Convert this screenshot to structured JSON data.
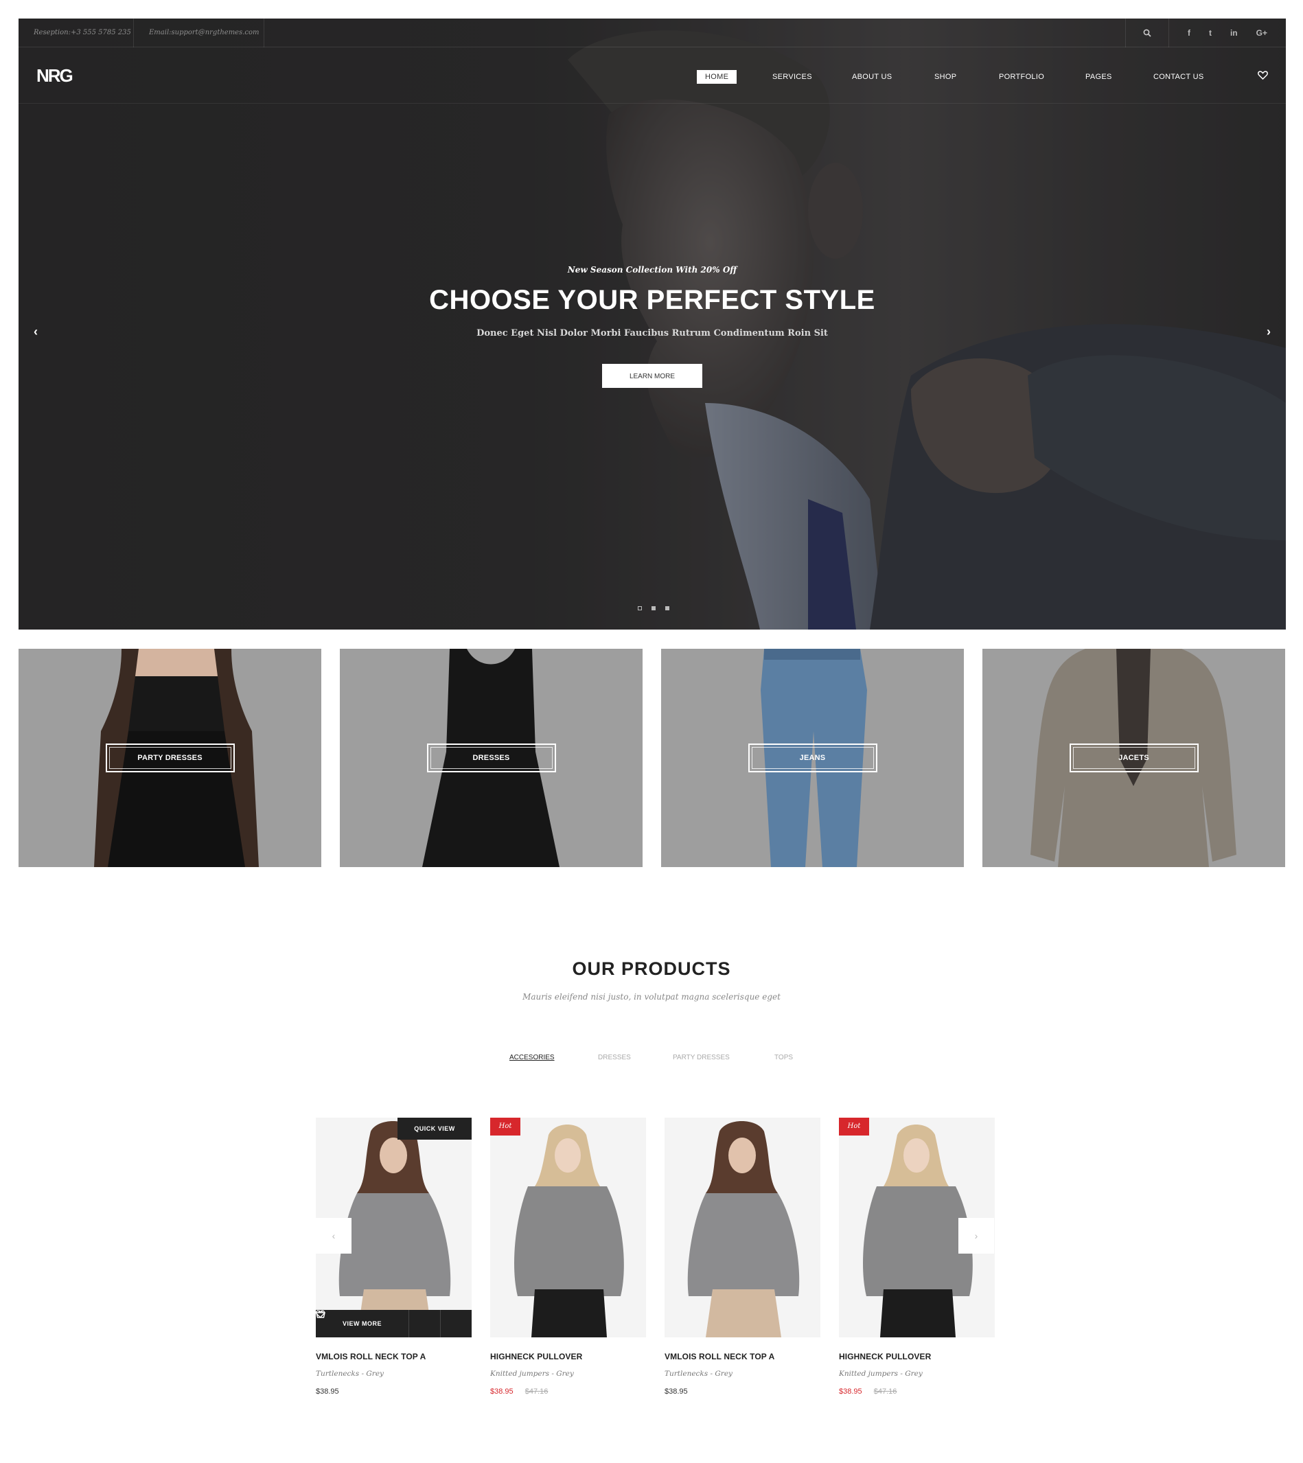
{
  "topbar": {
    "phone": "Reseption:+3 555 5785 235",
    "email": "Email:support@nrgthemes.com",
    "social_icons": [
      "facebook-icon",
      "twitter-icon",
      "linkedin-icon",
      "google-plus-icon"
    ],
    "social_glyphs": [
      "f",
      "t",
      "in",
      "G+"
    ]
  },
  "nav": {
    "logo": "NRG",
    "items": [
      "HOME",
      "SERVICES",
      "ABOUT US",
      "SHOP",
      "PORTFOLIO",
      "PAGES",
      "CONTACT US"
    ],
    "active": "HOME"
  },
  "hero": {
    "eyebrow": "New Season Collection With 20% Off",
    "headline": "CHOOSE YOUR PERFECT STYLE",
    "subheadline": "Donec Eget Nisl Dolor Morbi Faucibus Rutrum Condimentum Roin Sit",
    "button": "LEARN MORE",
    "slide_count": 3,
    "active_slide": 1
  },
  "categories": [
    "PARTY DRESSES",
    "DRESSES",
    "JEANS",
    "JACETS"
  ],
  "products_section": {
    "title": "OUR PRODUCTS",
    "subtitle": "Mauris eleifend nisi justo, in volutpat magna scelerisque eget",
    "filters": [
      "ACCESORIES",
      "DRESSES",
      "PARTY DRESSES",
      "TOPS"
    ],
    "active_filter": "ACCESORIES",
    "quick_view": "QUICK VIEW",
    "view_more": "VIEW MORE",
    "products": [
      {
        "name": "VMLOIS ROLL NECK TOP A",
        "category": "Turtlenecks - Grey",
        "price": "$38.95",
        "old_price": "",
        "badge": ""
      },
      {
        "name": "HIGHNECK PULLOVER",
        "category": "Knitted jumpers - Grey",
        "price": "$38.95",
        "old_price": "$47.16",
        "badge": "Hot"
      },
      {
        "name": "VMLOIS ROLL NECK TOP A",
        "category": "Turtlenecks - Grey",
        "price": "$38.95",
        "old_price": "",
        "badge": ""
      },
      {
        "name": "HIGHNECK PULLOVER",
        "category": "Knitted jumpers - Grey",
        "price": "$38.95",
        "old_price": "$47.16",
        "badge": "Hot"
      }
    ]
  },
  "colors": {
    "accent_red": "#d7272c",
    "dark": "#222222",
    "hero_bg": "#2e2d2e"
  }
}
